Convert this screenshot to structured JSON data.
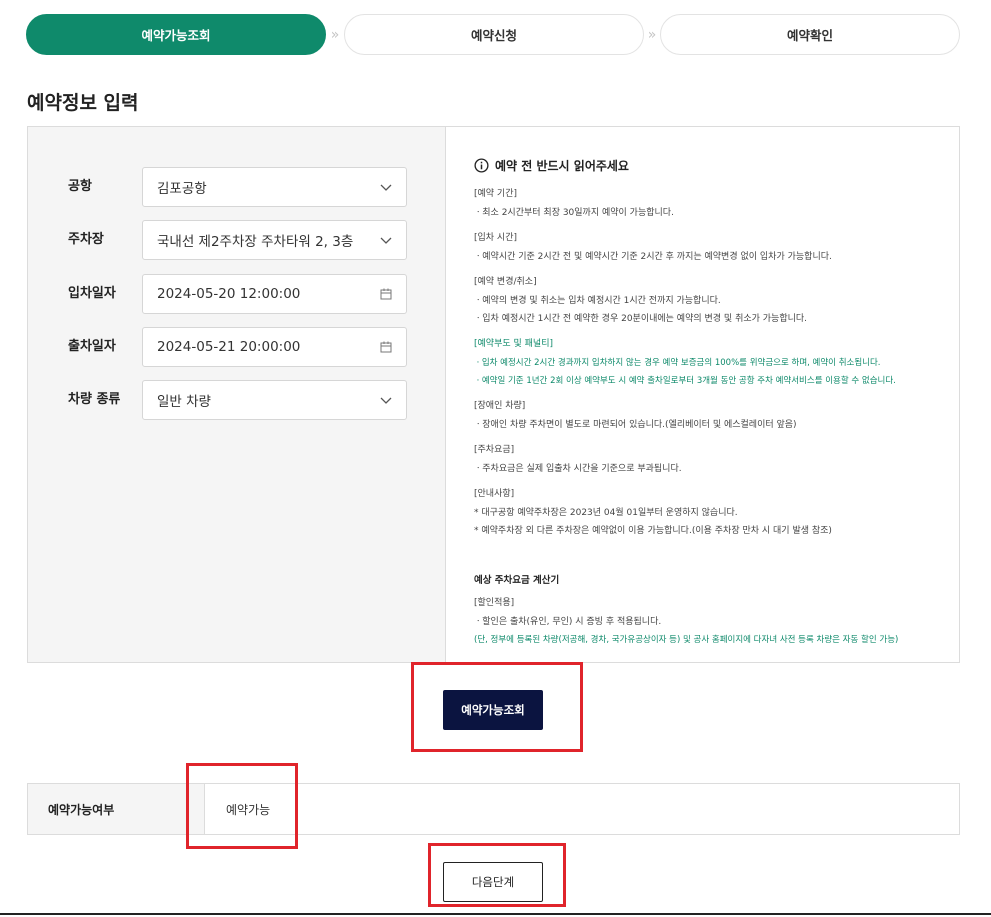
{
  "steps": [
    {
      "label": "예약가능조회",
      "active": true
    },
    {
      "label": "예약신청",
      "active": false
    },
    {
      "label": "예약확인",
      "active": false
    }
  ],
  "step_separator": "»",
  "section_title": "예약정보 입력",
  "form": {
    "airport": {
      "label": "공항",
      "value": "김포공항",
      "icon": "chevron-down-icon"
    },
    "parking": {
      "label": "주차장",
      "value": "국내선 제2주차장 주차타워 2, 3층",
      "icon": "chevron-down-icon"
    },
    "entry": {
      "label": "입차일자",
      "value": "2024-05-20 12:00:00",
      "icon": "calendar-icon"
    },
    "exit": {
      "label": "출차일자",
      "value": "2024-05-21 20:00:00",
      "icon": "calendar-icon"
    },
    "vehicle": {
      "label": "차량 종류",
      "value": "일반 차량",
      "icon": "chevron-down-icon"
    }
  },
  "notice": {
    "title": "예약 전 반드시 읽어주세요",
    "blocks": [
      {
        "heading": "[예약 기간]",
        "lines": [
          "ㆍ최소 2시간부터 최장 30일까지 예약이 가능합니다."
        ]
      },
      {
        "heading": "[입차 시간]",
        "lines": [
          "ㆍ예약시간 기준 2시간 전 및 예약시간 기준 2시간 후 까지는 예약변경 없이 입차가 가능합니다."
        ]
      },
      {
        "heading": "[예약 변경/취소]",
        "lines": [
          "ㆍ예약의 변경 및 취소는 입차 예정시간 1시간 전까지 가능합니다.",
          "ㆍ입차 예정시간 1시간 전 예약한 경우 20분이내에는 예약의 변경 및 취소가 가능합니다."
        ]
      },
      {
        "heading": "[예약부도 및 패널티]",
        "lines": [
          "ㆍ입차 예정시간 2시간 경과까지 입차하지 않는 경우 예약 보증금의 100%를 위약금으로 하며, 예약이 취소됩니다.",
          "ㆍ예약일 기준 1년간 2회 이상 예약부도 시 예약 출차일로부터 3개월 동안 공항 주차 예약서비스를 이용할 수 없습니다."
        ]
      },
      {
        "heading": "[장애인 차량]",
        "lines": [
          "ㆍ장애인 차량 주차면이 별도로 마련되어 있습니다.(엘리베이터 및 에스컬레이터 앞음)"
        ]
      },
      {
        "heading": "[주차요금]",
        "lines": [
          "ㆍ주차요금은 실제 입출차 시간을 기준으로 부과됩니다."
        ]
      },
      {
        "heading": "[안내사항]",
        "lines": [
          "* 대구공항 예약주차장은 2023년 04월 01일부터 운영하지 않습니다.",
          "* 예약주차장 외 다른 주차장은 예약없이 이용 가능합니다.(이용 주차장 만차 시 대기 발생 참조)"
        ]
      }
    ],
    "calc_title": "예상 주차요금 계산기",
    "calc_heading": "[할인적용]",
    "calc_line": "ㆍ할인은 출차(유인, 무인) 시 증빙 후 적용됩니다.",
    "calc_note": "(단, 정부에 등록된 차량(저공해, 경차, 국가유공상이자 등) 및 공사 홈페이지에 다자녀 사전 등록 차량은 자동 할인 가능)"
  },
  "search_button": "예약가능조회",
  "result": {
    "label": "예약가능여부",
    "value": "예약가능"
  },
  "next_button": "다음단계",
  "colors": {
    "accent": "#0f8a6b",
    "navy": "#0b1440",
    "highlight": "#e0242b"
  }
}
